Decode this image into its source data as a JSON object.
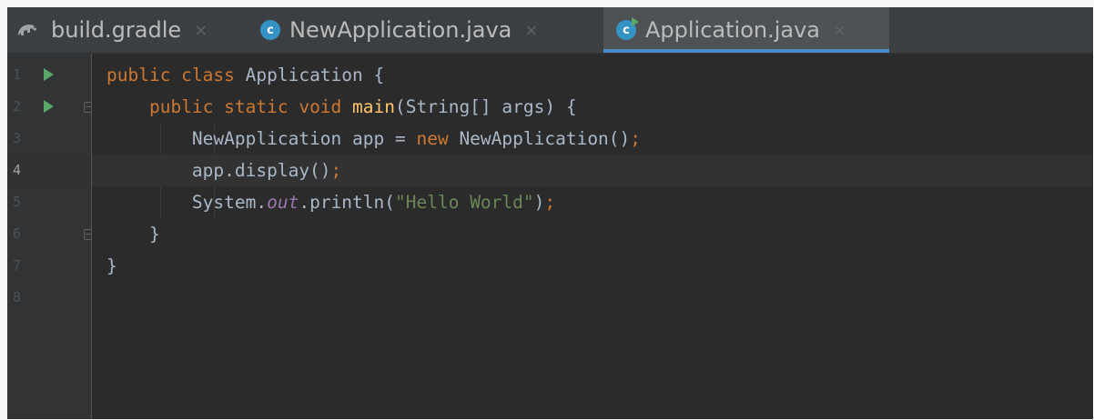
{
  "tabs": [
    {
      "label": "build.gradle",
      "close": "×",
      "icon": "gradle-icon",
      "active": false
    },
    {
      "label": "NewApplication.java",
      "close": "×",
      "icon": "java-class-icon",
      "active": false
    },
    {
      "label": "Application.java",
      "close": "×",
      "icon": "java-class-runnable-icon",
      "active": true
    }
  ],
  "class_icon_letter": "c",
  "current_line": 4,
  "lines": [
    {
      "number": "1",
      "tokens": [
        {
          "t": "public class ",
          "c": "kw"
        },
        {
          "t": "Application {",
          "c": "pl"
        }
      ]
    },
    {
      "number": "2",
      "tokens": [
        {
          "t": "    ",
          "c": "pl"
        },
        {
          "t": "public static void ",
          "c": "kw"
        },
        {
          "t": "main",
          "c": "fn"
        },
        {
          "t": "(String[] args) {",
          "c": "pl"
        }
      ]
    },
    {
      "number": "3",
      "tokens": [
        {
          "t": "        NewApplication app = ",
          "c": "pl"
        },
        {
          "t": "new ",
          "c": "kw"
        },
        {
          "t": "NewApplication()",
          "c": "pl"
        },
        {
          "t": ";",
          "c": "kw"
        }
      ]
    },
    {
      "number": "4",
      "tokens": [
        {
          "t": "        app.display()",
          "c": "pl"
        },
        {
          "t": ";",
          "c": "kw"
        }
      ]
    },
    {
      "number": "5",
      "tokens": [
        {
          "t": "        System.",
          "c": "pl"
        },
        {
          "t": "out",
          "c": "fld"
        },
        {
          "t": ".println(",
          "c": "pl"
        },
        {
          "t": "\"Hello World\"",
          "c": "str"
        },
        {
          "t": ")",
          "c": "pl"
        },
        {
          "t": ";",
          "c": "kw"
        }
      ]
    },
    {
      "number": "6",
      "tokens": [
        {
          "t": "    }",
          "c": "pl"
        }
      ]
    },
    {
      "number": "7",
      "tokens": [
        {
          "t": "}",
          "c": "pl"
        }
      ]
    },
    {
      "number": "8",
      "tokens": []
    }
  ],
  "colors": {
    "keyword": "#cc7832",
    "method": "#ffc66d",
    "string": "#6a8759",
    "static_field": "#9876aa",
    "text": "#a9b7c6",
    "background": "#2b2b2b",
    "tab_underline": "#4a88c7",
    "run_marker": "#59a869"
  }
}
